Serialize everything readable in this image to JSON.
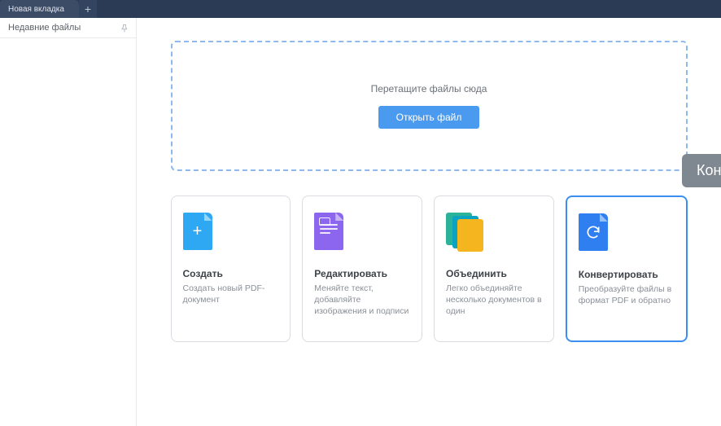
{
  "tabbar": {
    "tab_label": "Новая вкладка",
    "new_tab_glyph": "+"
  },
  "sidebar": {
    "recent_files_title": "Недавние файлы"
  },
  "dropzone": {
    "hint": "Перетащите файлы сюда",
    "open_button": "Открыть файл"
  },
  "cards": {
    "create": {
      "title": "Создать",
      "desc": "Создать новый PDF-документ"
    },
    "edit": {
      "title": "Редактировать",
      "desc": "Меняйте текст, добавляйте изображения и подписи"
    },
    "merge": {
      "title": "Объединить",
      "desc": "Легко объединяйте несколько документов в один"
    },
    "convert": {
      "title": "Конвертировать",
      "desc": "Преобразуйте файлы в формат PDF и обратно"
    }
  },
  "tooltip": {
    "text": "Конвертировать"
  }
}
